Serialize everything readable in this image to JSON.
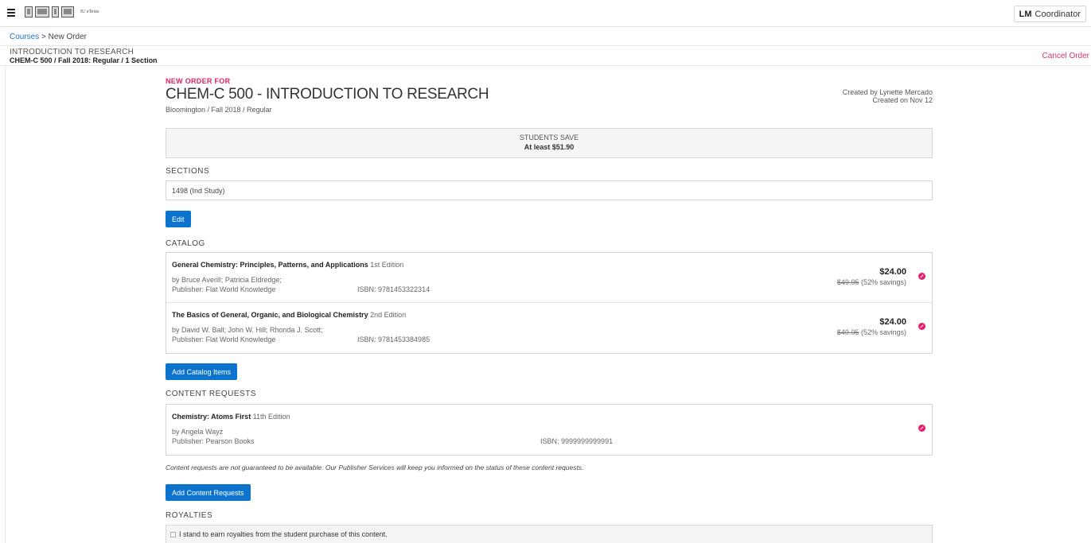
{
  "topbar": {
    "logo_text": "IU eTexts",
    "user_initials": "LM",
    "user_role": "Coordinator"
  },
  "breadcrumb": {
    "courses": "Courses",
    "separator": " > ",
    "current": "New Order"
  },
  "course": {
    "title": "INTRODUCTION TO RESEARCH",
    "summary": "CHEM-C 500 / Fall 2018: Regular / 1 Section",
    "cancel_label": "Cancel Order"
  },
  "order": {
    "kicker": "NEW ORDER FOR",
    "title": "CHEM-C 500 - INTRODUCTION TO RESEARCH",
    "subtitle": "Bloomington / Fall 2018 / Regular",
    "created_by": "Created by Lynette Mercado",
    "created_on": "Created on Nov 12"
  },
  "savings": {
    "label": "STUDENTS SAVE",
    "amount": "At least $51.90"
  },
  "sections": {
    "label": "SECTIONS",
    "value": "1498 (Ind Study)",
    "edit_label": "Edit"
  },
  "catalog": {
    "label": "CATALOG",
    "add_label": "Add Catalog Items",
    "items": [
      {
        "title": "General Chemistry: Principles, Patterns, and Applications",
        "edition": "1st Edition",
        "authors": "by Bruce Averill; Patricia Eldredge;",
        "publisher": "Publisher: Flat World Knowledge",
        "isbn": "ISBN: 9781453322314",
        "price": "$24.00",
        "original_price": "$49.95",
        "savings": "(52% savings)"
      },
      {
        "title": "The Basics of General, Organic, and Biological Chemistry",
        "edition": "2nd Edition",
        "authors": "by David W. Ball; John W. Hill; Rhonda J. Scott;",
        "publisher": "Publisher: Flat World Knowledge",
        "isbn": "ISBN: 9781453384985",
        "price": "$24.00",
        "original_price": "$49.95",
        "savings": "(52% savings)"
      }
    ]
  },
  "content_requests": {
    "label": "CONTENT REQUESTS",
    "add_label": "Add Content Requests",
    "disclaimer": "Content requests are not guaranteed to be available. Our Publisher Services will keep you informed on the status of these content requests.",
    "items": [
      {
        "title": "Chemistry: Atoms First",
        "edition": "11th Edition",
        "authors": "by Angela Wayz",
        "publisher": "Publisher: Pearson Books",
        "isbn": "ISBN: 9999999999991"
      }
    ]
  },
  "royalties": {
    "label": "ROYALTIES",
    "checkbox_label": "I stand to earn royalties from the student purchase of this content."
  }
}
